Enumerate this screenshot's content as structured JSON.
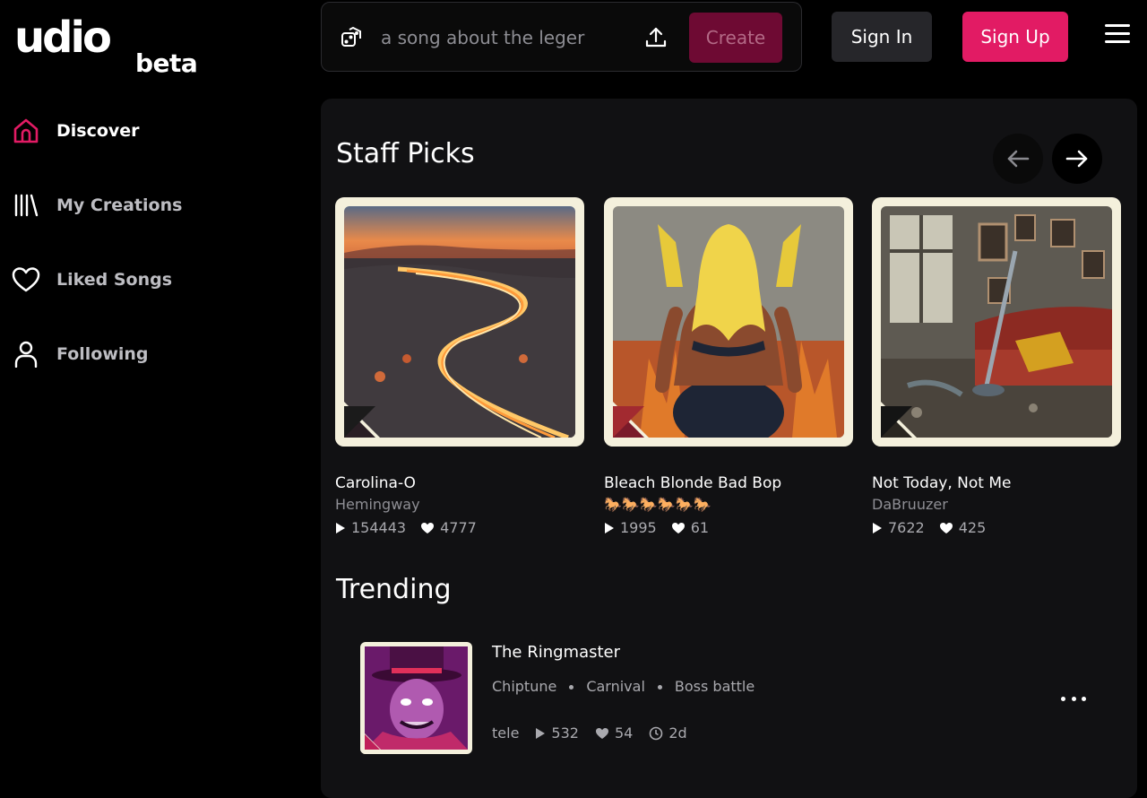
{
  "logo": {
    "word": "udio",
    "tag": "beta"
  },
  "prompt": {
    "text": "a song about the leger",
    "create_label": "Create",
    "dice_icon": "dice-icon",
    "upload_icon": "upload-icon"
  },
  "auth": {
    "signin_label": "Sign In",
    "signup_label": "Sign Up"
  },
  "colors": {
    "accent": "#e21b64",
    "create_disabled": "#6e0a33",
    "panel": "#111113",
    "card_frame": "#f4f0dc"
  },
  "sidebar": {
    "items": [
      {
        "label": "Discover",
        "icon": "home-icon",
        "active": true
      },
      {
        "label": "My Creations",
        "icon": "library-icon",
        "active": false
      },
      {
        "label": "Liked Songs",
        "icon": "heart-icon",
        "active": false
      },
      {
        "label": "Following",
        "icon": "user-icon",
        "active": false
      }
    ]
  },
  "staff_picks": {
    "title": "Staff Picks",
    "cards": [
      {
        "title": "Carolina-O",
        "artist": "Hemingway",
        "plays": "154443",
        "likes": "4777",
        "art": "highway-sunset"
      },
      {
        "title": "Bleach Blonde Bad Bop",
        "artist": "🐎🐎🐎🐎🐎🐎",
        "plays": "1995",
        "likes": "61",
        "art": "blonde-figure"
      },
      {
        "title": "Not Today, Not Me",
        "artist": "DaBruuzer",
        "plays": "7622",
        "likes": "425",
        "art": "messy-room"
      }
    ]
  },
  "trending": {
    "title": "Trending",
    "items": [
      {
        "title": "The Ringmaster",
        "tags": [
          "Chiptune",
          "Carnival",
          "Boss battle"
        ],
        "artist": "tele",
        "plays": "532",
        "likes": "54",
        "age": "2d",
        "art": "ringmaster"
      }
    ]
  }
}
